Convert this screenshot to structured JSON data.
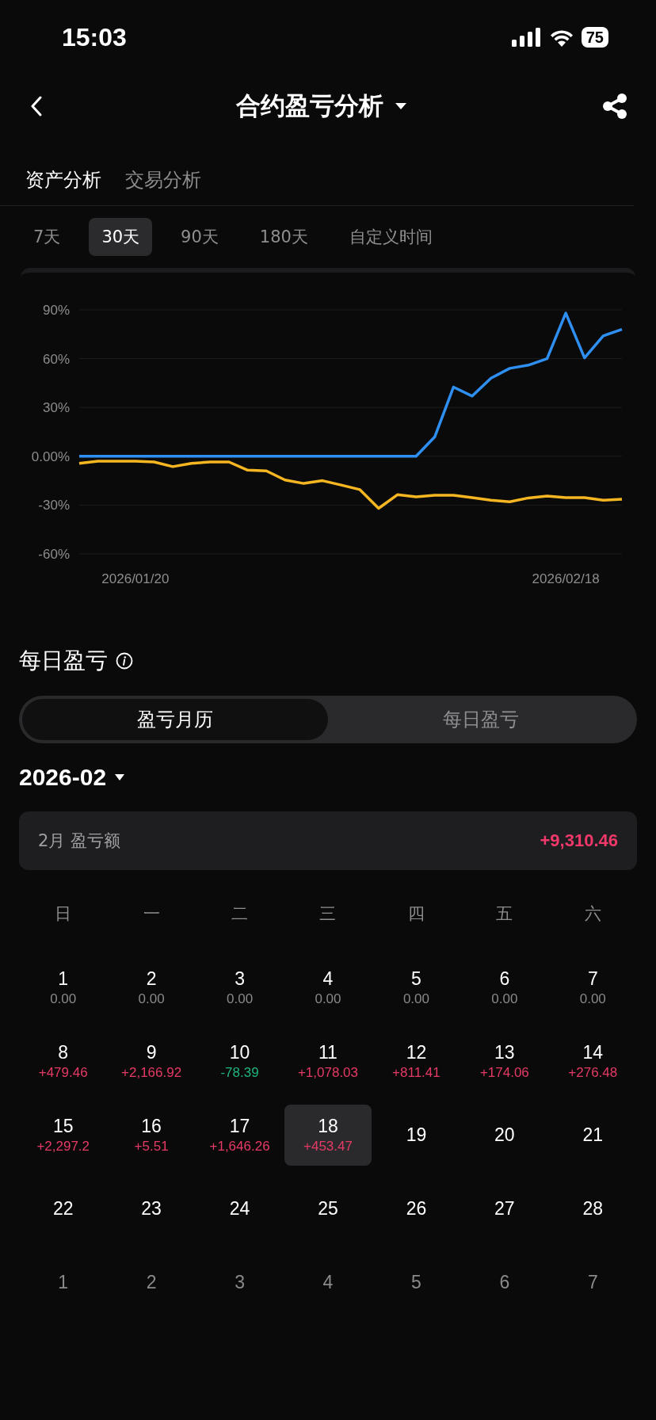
{
  "status_bar": {
    "time": "15:03",
    "battery": "75"
  },
  "nav": {
    "title": "合约盈亏分析"
  },
  "tabs": [
    {
      "label": "资产分析",
      "selected": true
    },
    {
      "label": "交易分析",
      "selected": false
    }
  ],
  "periods": [
    {
      "label": "7天",
      "selected": false
    },
    {
      "label": "30天",
      "selected": true
    },
    {
      "label": "90天",
      "selected": false
    },
    {
      "label": "180天",
      "selected": false
    },
    {
      "label": "自定义时间",
      "selected": false
    }
  ],
  "chart": {
    "chart_data": {
      "type": "line",
      "categories": [
        null,
        null,
        null,
        "2026/01/20",
        null,
        null,
        null,
        null,
        null,
        null,
        null,
        null,
        null,
        null,
        null,
        null,
        null,
        null,
        null,
        null,
        null,
        null,
        null,
        null,
        null,
        null,
        "2026/02/18",
        null,
        null,
        null
      ],
      "grid": true,
      "ylim": [
        -60,
        90
      ],
      "yticks": [
        {
          "value": 90,
          "label": "90%"
        },
        {
          "value": 60,
          "label": "60%"
        },
        {
          "value": 30,
          "label": "30%"
        },
        {
          "value": 0,
          "label": "0.00%"
        },
        {
          "value": -30,
          "label": "-30%"
        },
        {
          "value": -60,
          "label": "-60%"
        }
      ],
      "series": [
        {
          "color": "#2f8ff0",
          "values": [
            0,
            0,
            0,
            0,
            0,
            0,
            0,
            0,
            0,
            0,
            0,
            0,
            0,
            0,
            0,
            0,
            0,
            0,
            0,
            12,
            42.5,
            37,
            48,
            54,
            56,
            60,
            88,
            60.5,
            74,
            78
          ]
        },
        {
          "color": "#f5b622",
          "values": [
            -4.4,
            -3,
            -3,
            -3,
            -3.5,
            -6.4,
            -4.4,
            -3.5,
            -3.5,
            -8.5,
            -9,
            -14.6,
            -16.7,
            -15,
            -17.7,
            -20.5,
            -32,
            -23.6,
            -25,
            -24,
            -24,
            -25.4,
            -27,
            -28,
            -25.6,
            -24.4,
            -25.4,
            -25.4,
            -27,
            -26.4
          ]
        }
      ]
    }
  },
  "daily": {
    "title": "每日盈亏",
    "segments": [
      {
        "label": "盈亏月历",
        "selected": true
      },
      {
        "label": "每日盈亏",
        "selected": false
      }
    ],
    "month": "2026-02",
    "summary": {
      "label": "2月 盈亏额",
      "value": "+9,310.46",
      "color": "#f0386b"
    },
    "weekdays": [
      "日",
      "一",
      "二",
      "三",
      "四",
      "五",
      "六"
    ],
    "days": [
      {
        "day": "1",
        "value": "0.00",
        "color": "#8a8a8a",
        "in_month": true,
        "selected": false
      },
      {
        "day": "2",
        "value": "0.00",
        "color": "#8a8a8a",
        "in_month": true,
        "selected": false
      },
      {
        "day": "3",
        "value": "0.00",
        "color": "#8a8a8a",
        "in_month": true,
        "selected": false
      },
      {
        "day": "4",
        "value": "0.00",
        "color": "#8a8a8a",
        "in_month": true,
        "selected": false
      },
      {
        "day": "5",
        "value": "0.00",
        "color": "#8a8a8a",
        "in_month": true,
        "selected": false
      },
      {
        "day": "6",
        "value": "0.00",
        "color": "#8a8a8a",
        "in_month": true,
        "selected": false
      },
      {
        "day": "7",
        "value": "0.00",
        "color": "#8a8a8a",
        "in_month": true,
        "selected": false
      },
      {
        "day": "8",
        "value": "+479.46",
        "color": "#e63a66",
        "in_month": true,
        "selected": false
      },
      {
        "day": "9",
        "value": "+2,166.92",
        "color": "#e63a66",
        "in_month": true,
        "selected": false
      },
      {
        "day": "10",
        "value": "-78.39",
        "color": "#1fb57e",
        "in_month": true,
        "selected": false
      },
      {
        "day": "11",
        "value": "+1,078.03",
        "color": "#e63a66",
        "in_month": true,
        "selected": false
      },
      {
        "day": "12",
        "value": "+811.41",
        "color": "#e63a66",
        "in_month": true,
        "selected": false
      },
      {
        "day": "13",
        "value": "+174.06",
        "color": "#e63a66",
        "in_month": true,
        "selected": false
      },
      {
        "day": "14",
        "value": "+276.48",
        "color": "#e63a66",
        "in_month": true,
        "selected": false
      },
      {
        "day": "15",
        "value": "+2,297.2",
        "color": "#e63a66",
        "in_month": true,
        "selected": false
      },
      {
        "day": "16",
        "value": "+5.51",
        "color": "#e63a66",
        "in_month": true,
        "selected": false
      },
      {
        "day": "17",
        "value": "+1,646.26",
        "color": "#e63a66",
        "in_month": true,
        "selected": false
      },
      {
        "day": "18",
        "value": "+453.47",
        "color": "#e63a66",
        "in_month": true,
        "selected": true
      },
      {
        "day": "19",
        "in_month": true,
        "selected": false
      },
      {
        "day": "20",
        "in_month": true,
        "selected": false
      },
      {
        "day": "21",
        "in_month": true,
        "selected": false
      },
      {
        "day": "22",
        "in_month": true,
        "selected": false
      },
      {
        "day": "23",
        "in_month": true,
        "selected": false
      },
      {
        "day": "24",
        "in_month": true,
        "selected": false
      },
      {
        "day": "25",
        "in_month": true,
        "selected": false
      },
      {
        "day": "26",
        "in_month": true,
        "selected": false
      },
      {
        "day": "27",
        "in_month": true,
        "selected": false
      },
      {
        "day": "28",
        "in_month": true,
        "selected": false
      },
      {
        "day": "1",
        "in_month": false,
        "selected": false
      },
      {
        "day": "2",
        "in_month": false,
        "selected": false
      },
      {
        "day": "3",
        "in_month": false,
        "selected": false
      },
      {
        "day": "4",
        "in_month": false,
        "selected": false
      },
      {
        "day": "5",
        "in_month": false,
        "selected": false
      },
      {
        "day": "6",
        "in_month": false,
        "selected": false
      },
      {
        "day": "7",
        "in_month": false,
        "selected": false
      }
    ]
  }
}
